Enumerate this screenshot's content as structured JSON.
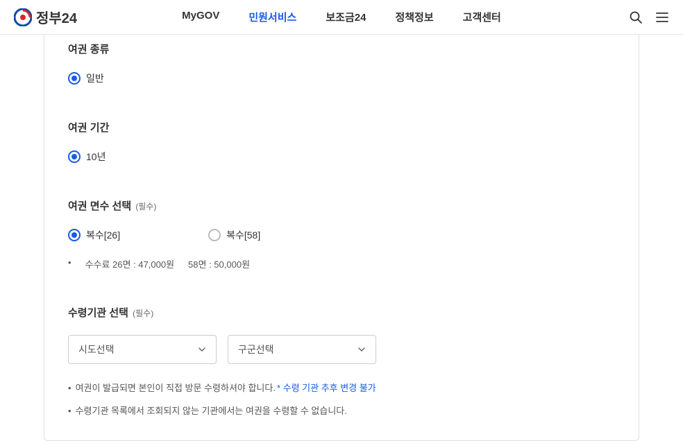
{
  "header": {
    "logo_text": "정부24",
    "nav": [
      {
        "label": "MyGOV",
        "active": false
      },
      {
        "label": "민원서비스",
        "active": true
      },
      {
        "label": "보조금24",
        "active": false
      },
      {
        "label": "정책정보",
        "active": false
      },
      {
        "label": "고객센터",
        "active": false
      }
    ]
  },
  "form": {
    "passport_type": {
      "title": "여권 종류",
      "options": [
        {
          "label": "일반",
          "selected": true
        }
      ]
    },
    "passport_period": {
      "title": "여권 기간",
      "options": [
        {
          "label": "10년",
          "selected": true
        }
      ]
    },
    "passport_pages": {
      "title": "여권 면수 선택",
      "required": "(필수)",
      "options": [
        {
          "label": "복수[26]",
          "selected": true
        },
        {
          "label": "복수[58]",
          "selected": false
        }
      ],
      "fee_note_1": "수수료 26면 : 47,000원",
      "fee_note_2": "58면 : 50,000원"
    },
    "receive_org": {
      "title": "수령기관 선택",
      "required": "(필수)",
      "select_sido": "시도선택",
      "select_gugun": "구군선택",
      "note1_text": "여권이 발급되면 본인이 직접 방문 수령하셔야 합니다.",
      "note1_warn": "* 수령 기관 추후 변경 불가",
      "note2": "수령기관 목록에서 조회되지 않는 기관에서는 여권을 수령할 수 없습니다."
    }
  }
}
